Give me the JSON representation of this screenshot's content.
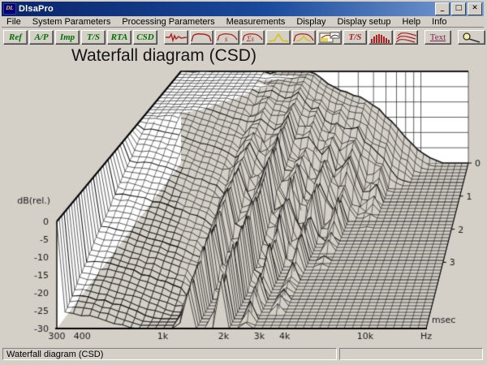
{
  "window": {
    "title": "DlsaPro",
    "minimize_glyph": "_",
    "maximize_glyph": "□",
    "close_glyph": "✕"
  },
  "menu": {
    "items": [
      "File",
      "System Parameters",
      "Processing Parameters",
      "Measurements",
      "Display",
      "Display setup",
      "Help",
      "Info"
    ]
  },
  "toolbar": {
    "text_buttons": [
      "Ref",
      "A/P",
      "Imp",
      "T/S",
      "RTA",
      "CSD"
    ],
    "icons": [
      "impulse-response",
      "frequency-response",
      "smoothing",
      "sum-smoothing",
      "window-function",
      "windowed-response",
      "gate-editor",
      "ts-parameters",
      "rta-bars",
      "waterfall",
      "text-labels",
      "zoom"
    ],
    "ts_icon_label": "T/S",
    "text_icon_label": "Text"
  },
  "statusbar": {
    "message": "Waterfall diagram (CSD)",
    "aux": ""
  },
  "chart_data": {
    "type": "waterfall",
    "title": "Waterfall diagram (CSD)",
    "freq_axis": {
      "unit_label": "Hz",
      "min_hz": 300,
      "max_hz": 20000,
      "tick_labels": [
        "300",
        "400",
        "1k",
        "2k",
        "3k",
        "4k",
        "10k"
      ],
      "tick_values": [
        300,
        400,
        1000,
        2000,
        3000,
        4000,
        10000
      ],
      "grid_values": [
        300,
        400,
        500,
        600,
        700,
        800,
        900,
        1000,
        2000,
        3000,
        4000,
        5000,
        6000,
        7000,
        8000,
        9000,
        10000,
        20000
      ]
    },
    "db_axis": {
      "label": "dB(rel.)",
      "min": -30,
      "max": 0,
      "ticks": [
        0,
        -5,
        -10,
        -15,
        -20,
        -25,
        -30
      ]
    },
    "time_axis": {
      "label": "msec",
      "ticks": [
        0,
        1,
        2,
        3
      ],
      "max_ms": 5
    },
    "surface_model": {
      "n_slices": 52,
      "n_freq_points": 46,
      "rolloff_start_frac": 0.47,
      "rolloff_db": -36,
      "onset_ms": 1.6,
      "onset_width_frac": 0.3,
      "decay_base_db_per_ms": 7.5,
      "decay_high_extra": 6.5,
      "decay_high_center_frac": 0.58,
      "resonances": [
        {
          "u": 0.349,
          "depth": 4.5,
          "w": 0.016
        },
        {
          "u": 0.44,
          "depth": 5.3,
          "w": 0.02
        },
        {
          "u": 0.514,
          "depth": 4.6,
          "w": 0.02
        },
        {
          "u": 0.578,
          "depth": 5.4,
          "w": 0.02
        },
        {
          "u": 0.645,
          "depth": 5.0,
          "w": 0.022
        },
        {
          "u": 0.729,
          "depth": 5.2,
          "w": 0.02
        },
        {
          "u": 0.797,
          "depth": 4.2,
          "w": 0.018
        }
      ]
    }
  }
}
